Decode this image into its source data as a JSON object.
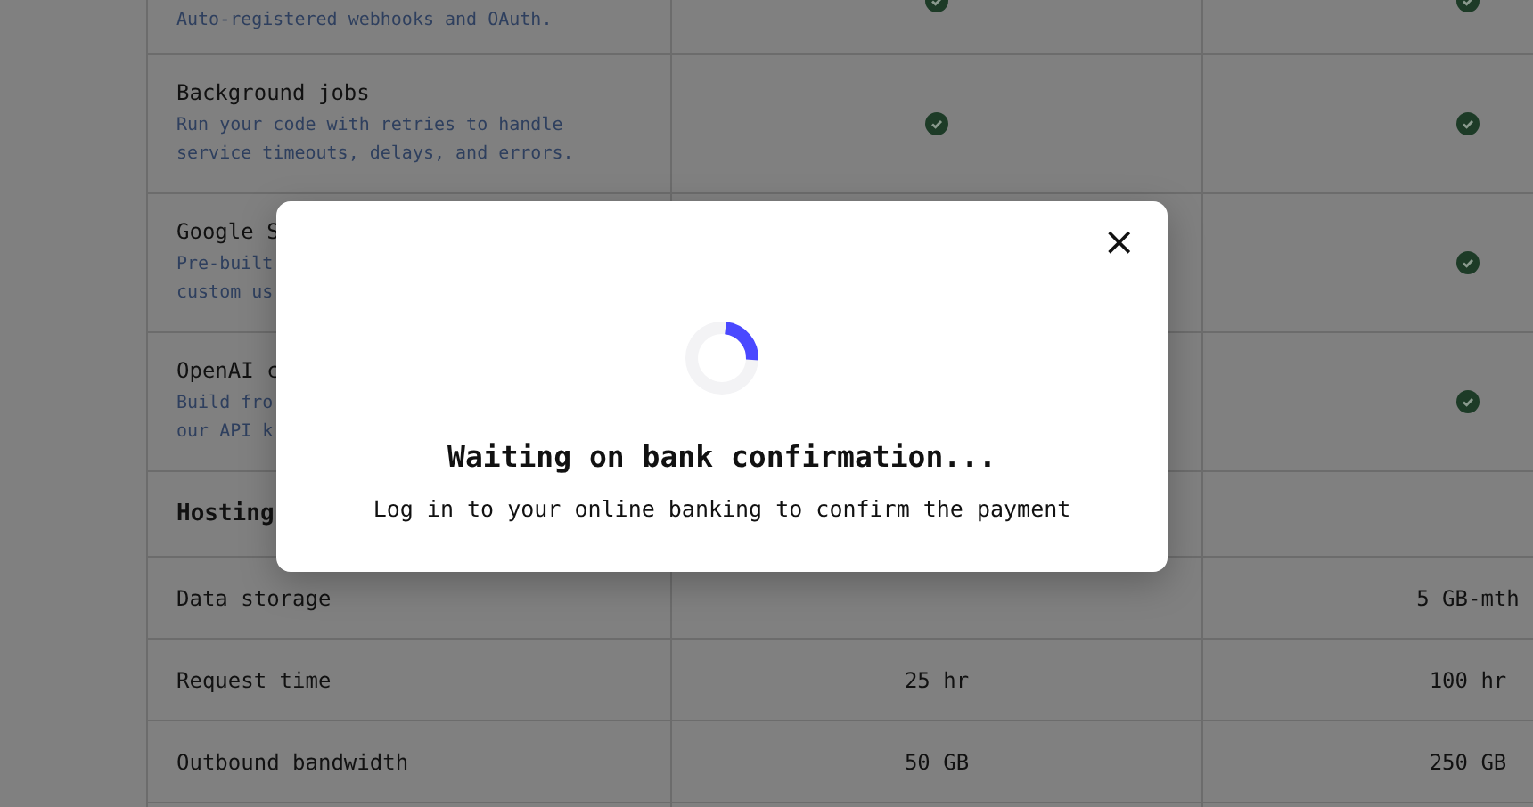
{
  "table": {
    "rows": [
      {
        "kind": "feature",
        "description": [
          "Auto-registered webhooks and OAuth."
        ],
        "checks": [
          true,
          true
        ]
      },
      {
        "kind": "feature",
        "title": "Background jobs",
        "description": [
          "Run your code with retries to handle",
          "service timeouts, delays, and errors."
        ],
        "checks": [
          true,
          true
        ]
      },
      {
        "kind": "feature",
        "title": "Google S",
        "description": [
          "Pre-built",
          "custom us"
        ],
        "checks": [
          true
        ]
      },
      {
        "kind": "feature",
        "title": "OpenAI c",
        "description": [
          "Build fro",
          "our API k"
        ],
        "checks": [
          true
        ]
      },
      {
        "kind": "section",
        "title": "Hosting"
      },
      {
        "kind": "metric",
        "title": "Data storage",
        "values": [
          "5 GB-mth"
        ]
      },
      {
        "kind": "metric",
        "title": "Request time",
        "values": [
          "25 hr",
          "100 hr"
        ]
      },
      {
        "kind": "metric",
        "title": "Outbound bandwidth",
        "values": [
          "50 GB",
          "250 GB"
        ]
      },
      {
        "kind": "blank"
      }
    ]
  },
  "modal": {
    "close": "×",
    "title": "Waiting on bank confirmation...",
    "message": "Log in to your online banking to confirm the payment"
  }
}
